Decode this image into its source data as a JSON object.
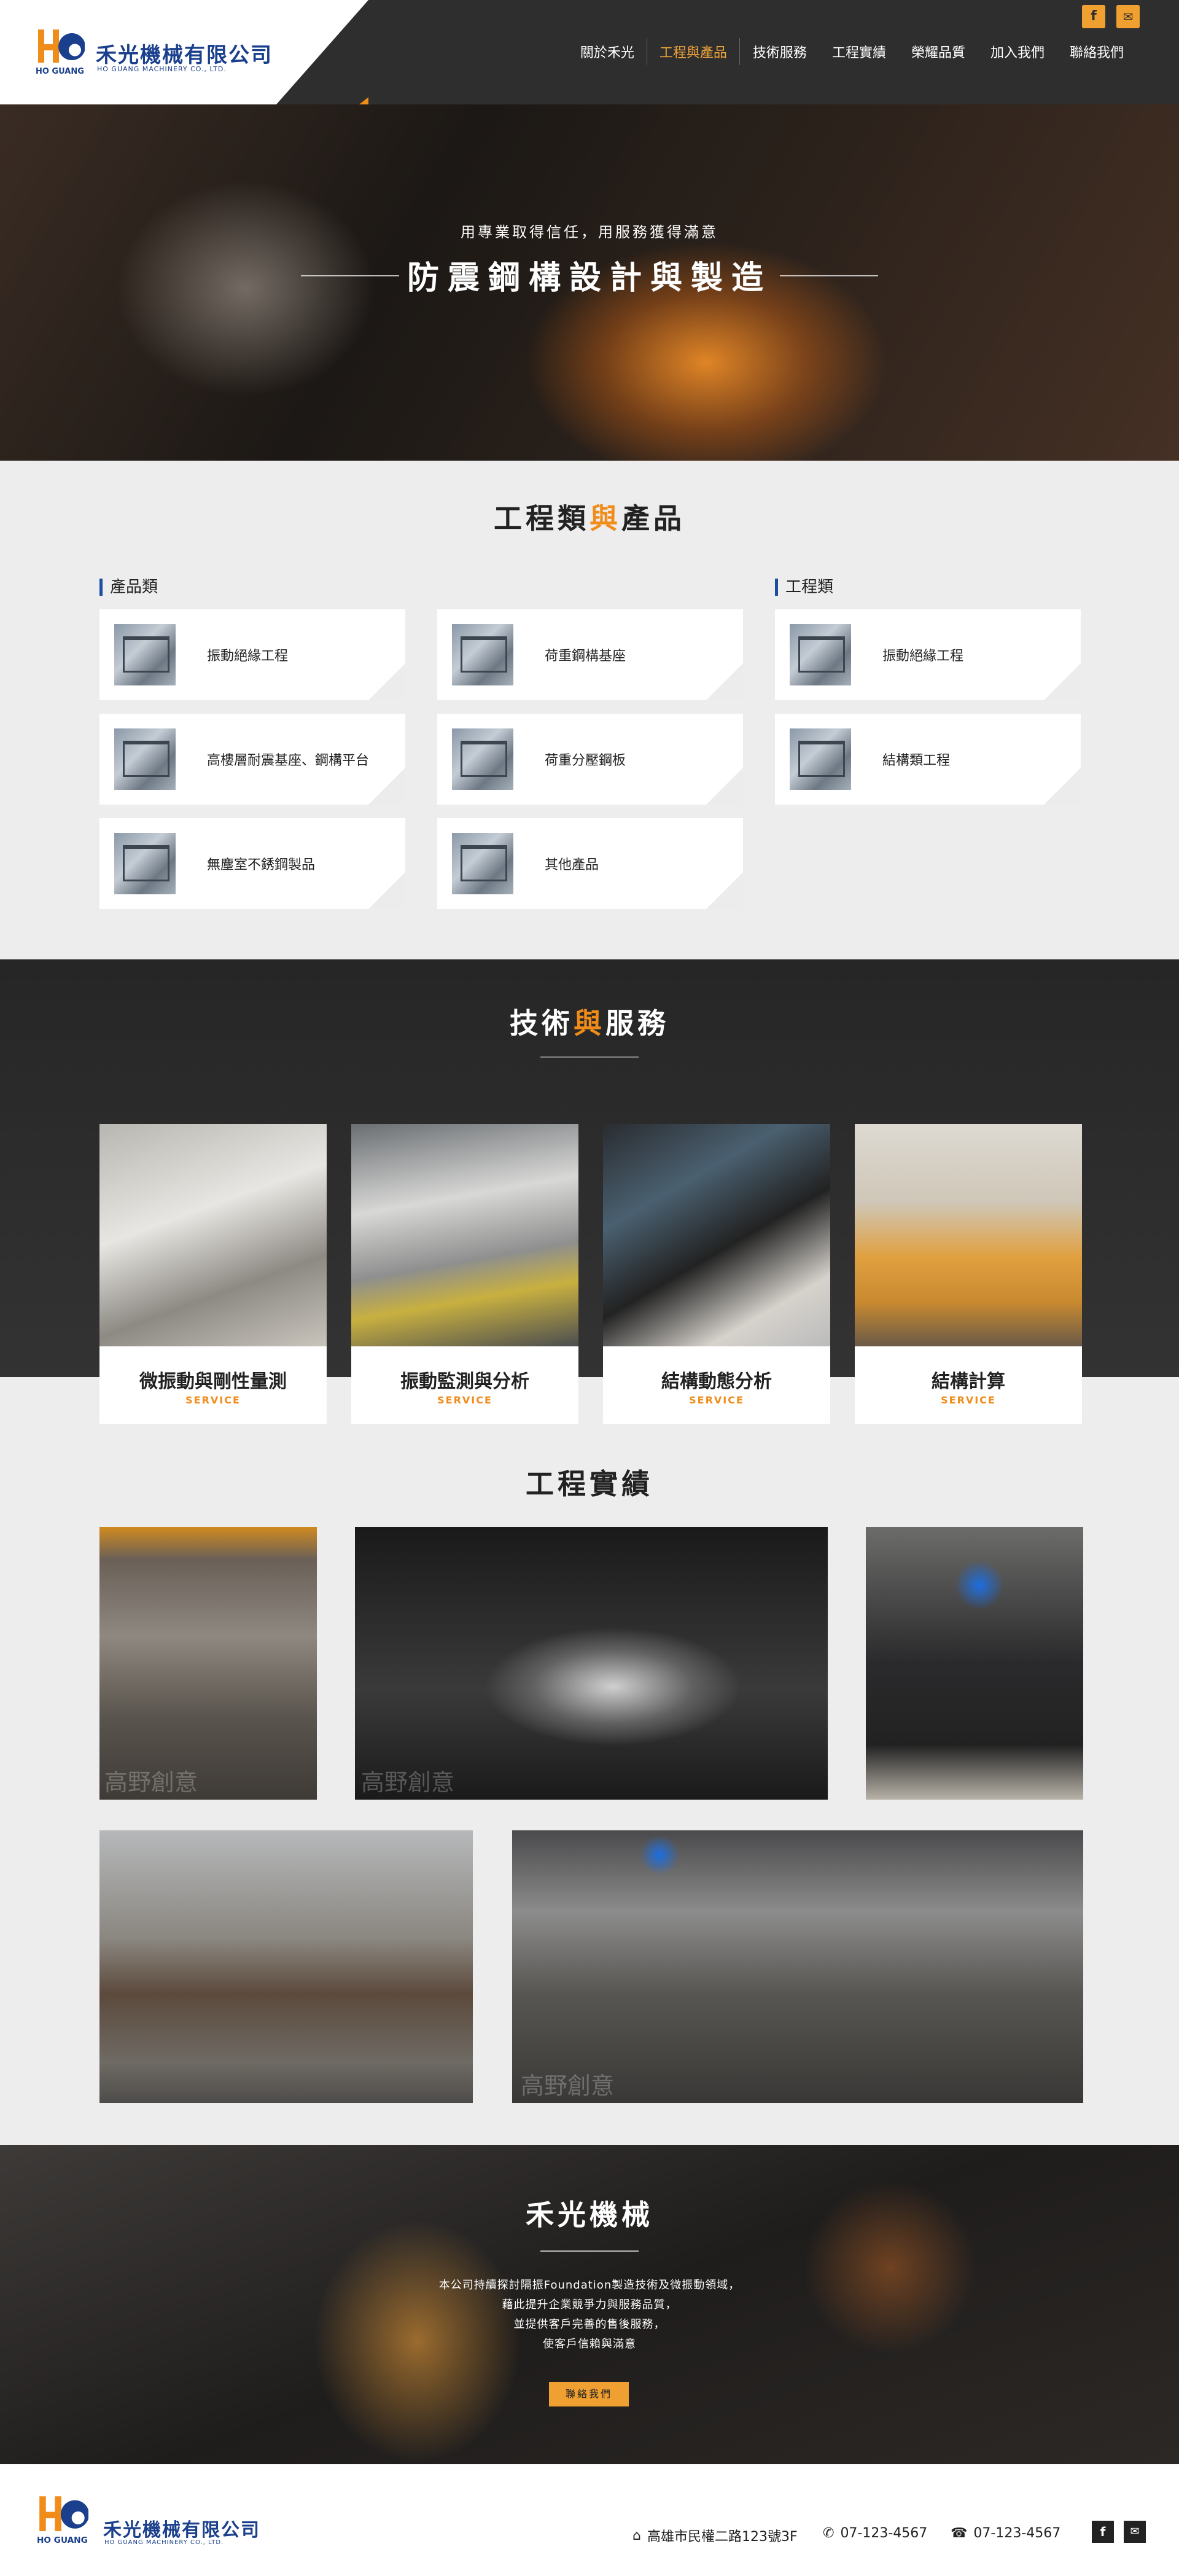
{
  "brand": {
    "name_zh": "禾光機械有限公司",
    "name_en": "HO GUANG MACHINERY CO., LTD.",
    "mark_text": "HO GUANG",
    "colors": {
      "orange": "#f08c1a",
      "blue": "#1a3f8c",
      "dark": "#2e2e2e"
    }
  },
  "header": {
    "nav": [
      "關於禾光",
      "工程與產品",
      "技術服務",
      "工程實績",
      "榮耀品質",
      "加入我們",
      "聯絡我們"
    ],
    "active_index": 1,
    "icons": [
      "facebook-icon",
      "mail-icon"
    ]
  },
  "hero": {
    "subtitle": "用專業取得信任，用服務獲得滿意",
    "title": "防震鋼構設計與製造"
  },
  "products": {
    "title_a": "工程類",
    "title_hl": "與",
    "title_b": "產品",
    "product_head": "產品類",
    "engineering_head": "工程類",
    "product_items": [
      "振動絕緣工程",
      "荷重鋼構基座",
      "高樓層耐震基座、鋼構平台",
      "荷重分壓鋼板",
      "無塵室不銹鋼製品",
      "其他產品"
    ],
    "engineering_items": [
      "振動絕緣工程",
      "結構類工程"
    ]
  },
  "tech": {
    "title_a": "技術",
    "title_hl": "與",
    "title_b": "服務",
    "services": [
      {
        "title": "微振動與剛性量測",
        "sub": "SERVICE"
      },
      {
        "title": "振動監測與分析",
        "sub": "SERVICE"
      },
      {
        "title": "結構動態分析",
        "sub": "SERVICE"
      },
      {
        "title": "結構計算",
        "sub": "SERVICE"
      }
    ]
  },
  "projects": {
    "title": "工程實績",
    "watermark": "高野創意"
  },
  "about": {
    "title": "禾光機械",
    "lines": [
      "本公司持續探討隔振Foundation製造技術及微振動領域，",
      "藉此提升企業競爭力與服務品質，",
      "並提供客戶完善的售後服務，",
      "使客戶信賴與滿意"
    ],
    "button": "聯絡我們"
  },
  "footer": {
    "address": "高雄市民權二路123號3F",
    "phone": "07-123-4567",
    "fax": "07-123-4567"
  }
}
